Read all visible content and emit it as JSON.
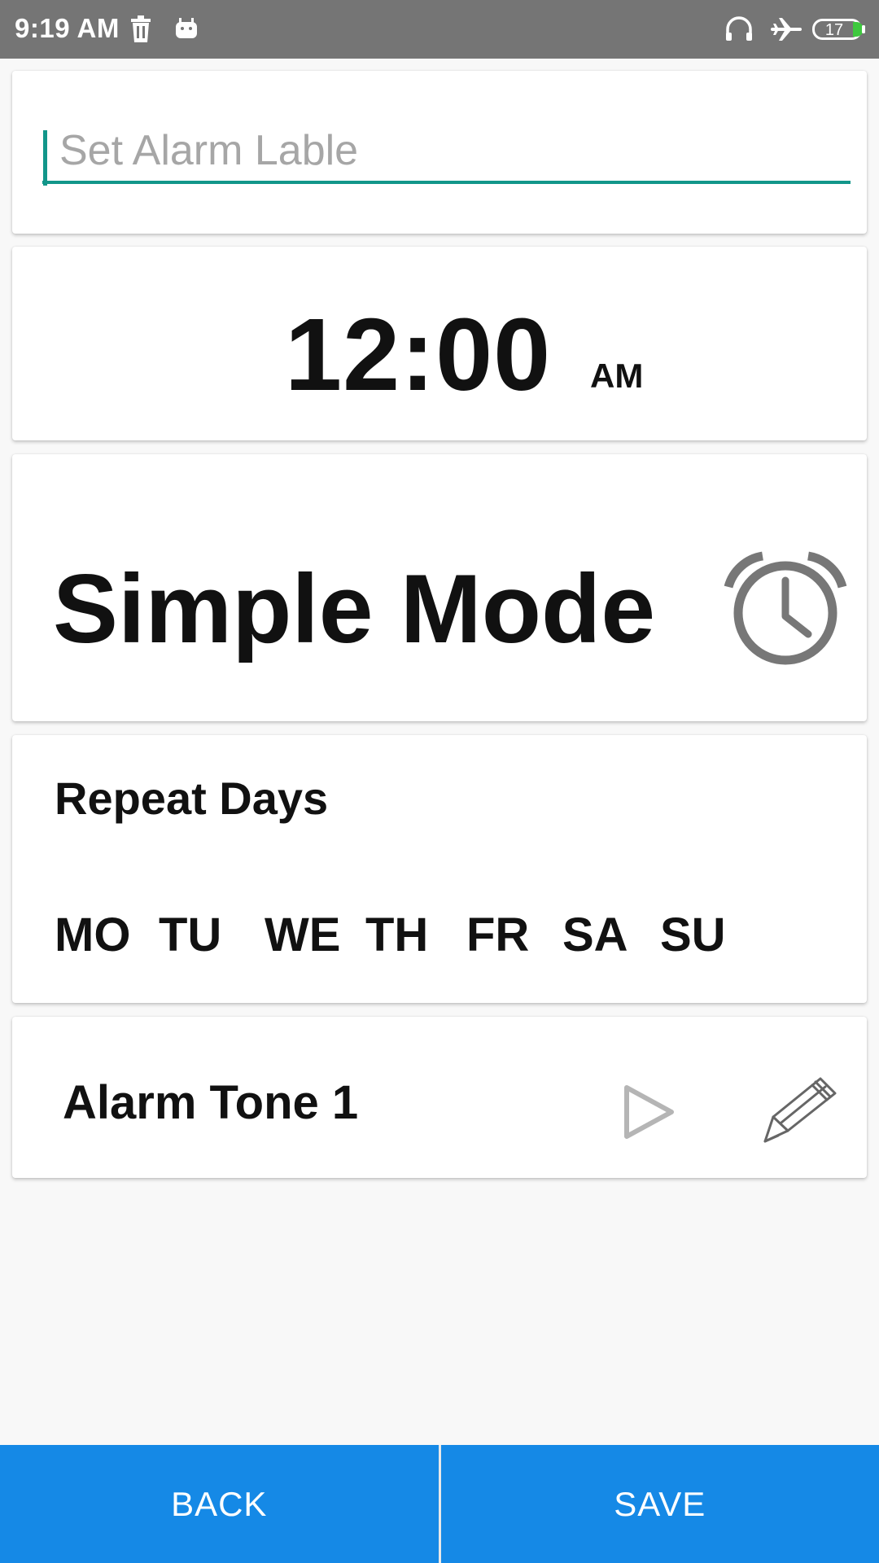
{
  "status_bar": {
    "time": "9:19 AM",
    "left_icons": [
      "trash-icon",
      "android-icon"
    ],
    "right_icons": [
      "headset-icon",
      "airplane-icon",
      "battery-icon"
    ],
    "battery_level": "17",
    "battery_accent": "#3ec83e"
  },
  "alarm_label": {
    "placeholder": "Set Alarm Lable",
    "value": "",
    "accent": "#12968a"
  },
  "time": {
    "value": "12:00",
    "period": "AM"
  },
  "mode": {
    "title": "Simple Mode",
    "icon": "alarm-clock-icon"
  },
  "repeat": {
    "title": "Repeat Days",
    "days": [
      "MO",
      "TU",
      "WE",
      "TH",
      "FR",
      "SA",
      "SU"
    ]
  },
  "tone": {
    "name": "Alarm Tone 1",
    "play_icon": "play-icon",
    "edit_icon": "pencil-icon"
  },
  "actions": {
    "back_label": "BACK",
    "save_label": "SAVE",
    "color": "#1589e6"
  }
}
